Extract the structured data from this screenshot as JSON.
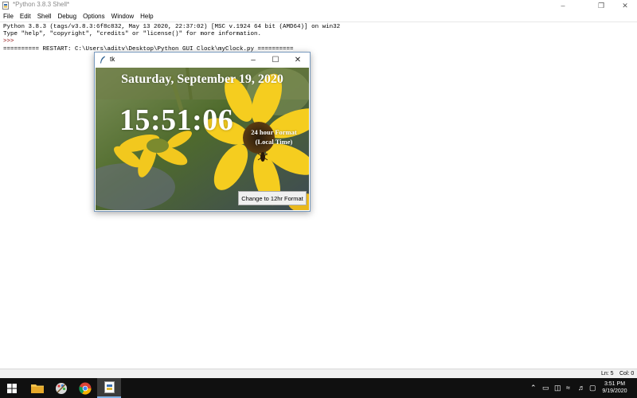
{
  "shell": {
    "title": "*Python 3.8.3 Shell*",
    "menu": [
      "File",
      "Edit",
      "Shell",
      "Debug",
      "Options",
      "Window",
      "Help"
    ],
    "lines": [
      "Python 3.8.3 (tags/v3.8.3:6f8c832, May 13 2020, 22:37:02) [MSC v.1924 64 bit (AMD64)] on win32",
      "Type \"help\", \"copyright\", \"credits\" or \"license()\" for more information.",
      ">>>",
      "========== RESTART: C:\\Users\\aditv\\Desktop\\Python GUI Clock\\myClock.py =========="
    ],
    "status": {
      "ln": "Ln: 5",
      "col": "Col: 0"
    }
  },
  "clock_window": {
    "title": "tk",
    "date": "Saturday, September 19, 2020",
    "time": "15:51:06",
    "format_label_line1": "24 hour Format",
    "format_label_line2": "(Local Time)",
    "toggle_button": "Change to 12hr Format"
  },
  "taskbar": {
    "time": "3:51 PM",
    "date": "9/19/2020"
  },
  "colors": {
    "taskbar": "#101010",
    "flower": "#f2c81e",
    "foliage": "#4f6b2c"
  }
}
